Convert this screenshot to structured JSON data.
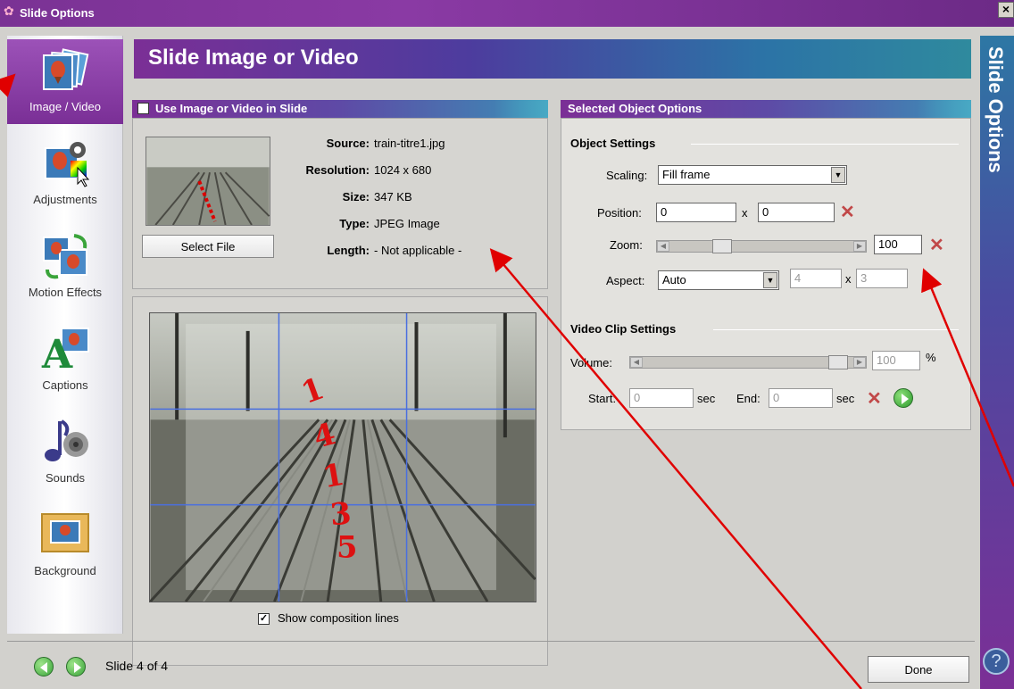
{
  "window": {
    "title": "Slide Options",
    "close_glyph": "×"
  },
  "nav": {
    "items": [
      {
        "label": "Image / Video",
        "icon": "image-video-icon",
        "active": true
      },
      {
        "label": "Adjustments",
        "icon": "adjustments-icon",
        "active": false
      },
      {
        "label": "Motion Effects",
        "icon": "motion-effects-icon",
        "active": false
      },
      {
        "label": "Captions",
        "icon": "captions-icon",
        "active": false
      },
      {
        "label": "Sounds",
        "icon": "sounds-icon",
        "active": false
      },
      {
        "label": "Background",
        "icon": "background-icon",
        "active": false
      }
    ]
  },
  "header": {
    "title": "Slide Image or Video"
  },
  "side_title": "Slide Options",
  "source": {
    "panel_title": "Use Image or Video in Slide",
    "use_checked": true,
    "select_file_label": "Select File",
    "meta": [
      {
        "label": "Source:",
        "value": "train-titre1.jpg"
      },
      {
        "label": "Resolution:",
        "value": "1024 x 680"
      },
      {
        "label": "Size:",
        "value": "347 KB"
      },
      {
        "label": "Type:",
        "value": "JPEG Image"
      },
      {
        "label": "Length:",
        "value": "- Not applicable -"
      }
    ],
    "overlay_numbers": "1 4 1 3 5"
  },
  "preview": {
    "show_composition_label": "Show composition lines",
    "show_composition_checked": true
  },
  "options": {
    "panel_title": "Selected Object Options",
    "object_settings": {
      "title": "Object Settings",
      "scaling_label": "Scaling:",
      "scaling_value": "Fill frame",
      "position_label": "Position:",
      "position_x": "0",
      "position_y": "0",
      "position_sep": "x",
      "zoom_label": "Zoom:",
      "zoom_value": "100",
      "aspect_label": "Aspect:",
      "aspect_value": "Auto",
      "aspect_w": "4",
      "aspect_h": "3",
      "aspect_sep": "x"
    },
    "video_settings": {
      "title": "Video Clip Settings",
      "volume_label": "Volume:",
      "volume_value": "100",
      "volume_unit": "%",
      "start_label": "Start:",
      "start_value": "0",
      "start_unit": "sec",
      "end_label": "End:",
      "end_value": "0",
      "end_unit": "sec"
    }
  },
  "footer": {
    "slide_counter": "Slide 4 of 4",
    "done_label": "Done"
  },
  "colors": {
    "accent_purple": "#7b2f96",
    "accent_blue": "#2c73a6",
    "annotation_red": "#e00000"
  }
}
